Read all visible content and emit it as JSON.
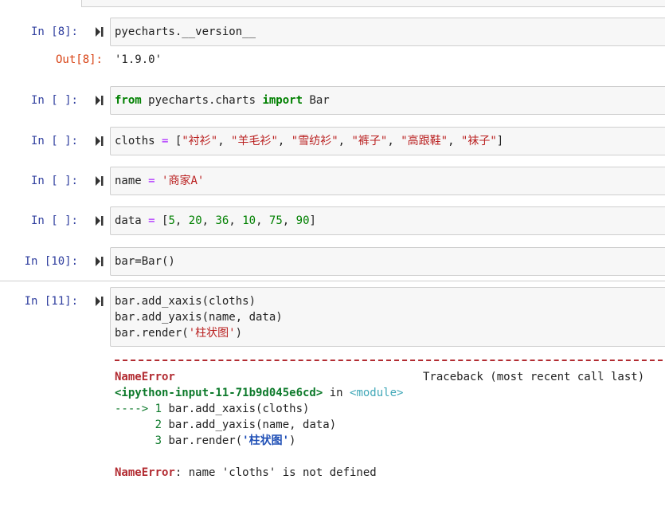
{
  "cells": [
    {
      "prompt": "In  [8]:",
      "code": "pyecharts.__version__",
      "output_prompt": "Out[8]:",
      "output": "'1.9.0'"
    },
    {
      "prompt": "In  [ ]:",
      "code_kw": "from",
      "code_mid": " pyecharts.charts ",
      "code_kw2": "import",
      "code_end": " Bar"
    },
    {
      "prompt": "In  [ ]:",
      "var": "cloths",
      "op": "=",
      "open": "[",
      "items": [
        "\"衬衫\"",
        "\"羊毛衫\"",
        "\"雪纺衫\"",
        "\"裤子\"",
        "\"高跟鞋\"",
        "\"袜子\""
      ],
      "sep": ", ",
      "close": "]"
    },
    {
      "prompt": "In  [ ]:",
      "var": "name",
      "op": "=",
      "value": "'商家A'"
    },
    {
      "prompt": "In  [ ]:",
      "var": "data",
      "op": "=",
      "open": "[",
      "values": [
        "5",
        "20",
        "36",
        "10",
        "75",
        "90"
      ],
      "sep": ", ",
      "close": "]"
    },
    {
      "prompt": "In [10]:",
      "code": "bar=Bar()"
    },
    {
      "prompt": "In [11]:",
      "lines": [
        "bar.add_xaxis(cloths)",
        "bar.add_yaxis(name, data)"
      ],
      "line3_pre": "bar.render(",
      "line3_str": "'柱状图'",
      "line3_post": ")",
      "traceback": {
        "error_name": "NameError",
        "traceback_label": "Traceback (most recent call last)",
        "location": "<ipython-input-11-71b9d045e6cd>",
        "in_word": " in ",
        "module": "<module>",
        "arrow": "----> 1 ",
        "tb_line1": "bar.add_xaxis(cloths)",
        "tb_line2_num": "      2 ",
        "tb_line2": "bar.add_yaxis(name, data)",
        "tb_line3_num": "      3 ",
        "tb_line3_pre": "bar.render(",
        "tb_line3_str": "'柱状图'",
        "tb_line3_post": ")",
        "final_name": "NameError",
        "final_msg": ": name 'cloths' is not defined"
      }
    }
  ]
}
